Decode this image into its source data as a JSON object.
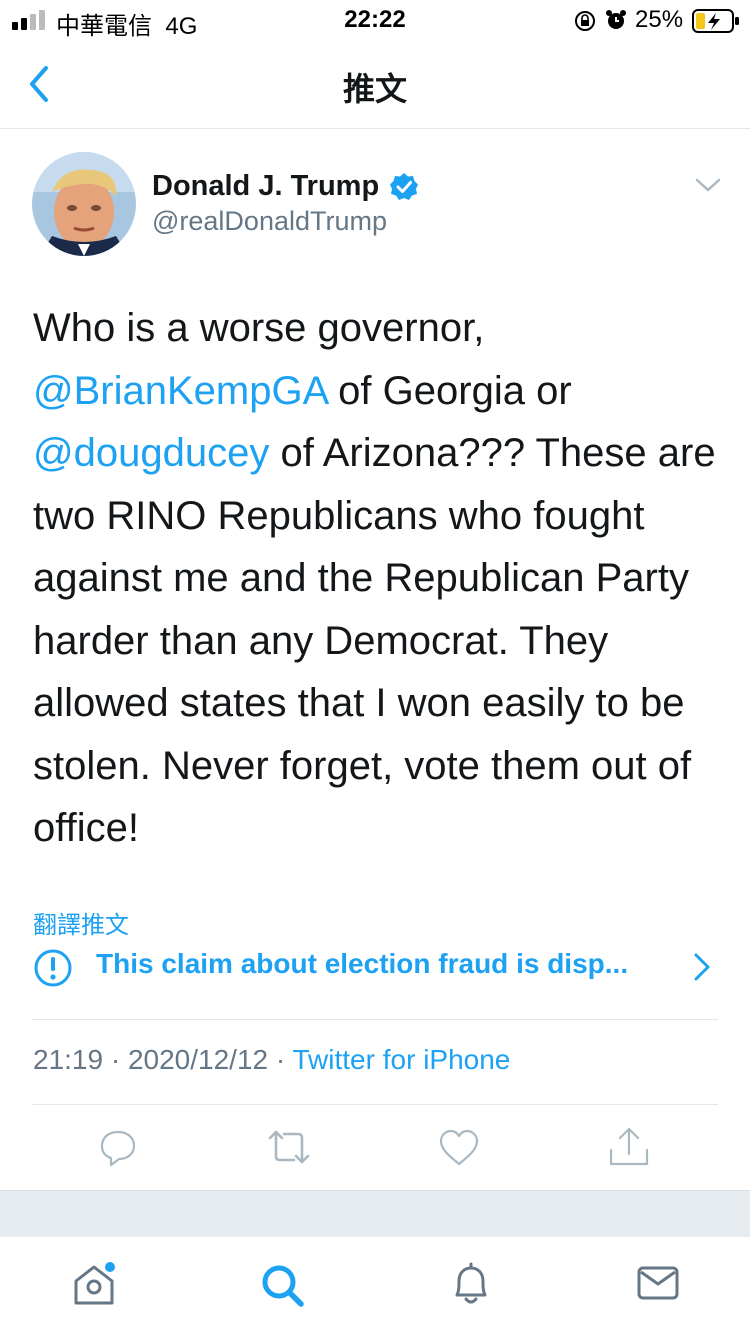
{
  "status_bar": {
    "carrier": "中華電信",
    "network": "4G",
    "time": "22:22",
    "battery": "25%"
  },
  "header": {
    "title": "推文"
  },
  "tweet": {
    "author_name": "Donald J. Trump",
    "handle": "@realDonaldTrump",
    "text_parts": [
      "Who is a worse governor, ",
      "@BrianKempGA",
      " of Georgia or ",
      "@dougducey",
      " of Arizona??? These are two RINO Republicans who fought against me and the Republican Party harder than any Democrat. They allowed states that I won easily to be stolen. Never forget, vote them out of office!"
    ],
    "translate_label": "翻譯推文",
    "claim_label": "This claim about election fraud is disp...",
    "time": "21:19",
    "date": "2020/12/12",
    "source": "Twitter for iPhone",
    "separator": "·"
  },
  "colors": {
    "accent": "#1da1f2",
    "text": "#14171a",
    "secondary": "#657786",
    "border": "#e1e8ed"
  },
  "icons": {
    "back": "chevron-left-icon",
    "more": "chevron-down-icon",
    "verified": "verified-badge-icon",
    "claim": "exclamation-circle-icon",
    "reply": "reply-icon",
    "retweet": "retweet-icon",
    "like": "heart-icon",
    "share": "share-icon",
    "home": "home-icon",
    "search": "search-icon",
    "notifications": "bell-icon",
    "messages": "mail-icon"
  }
}
